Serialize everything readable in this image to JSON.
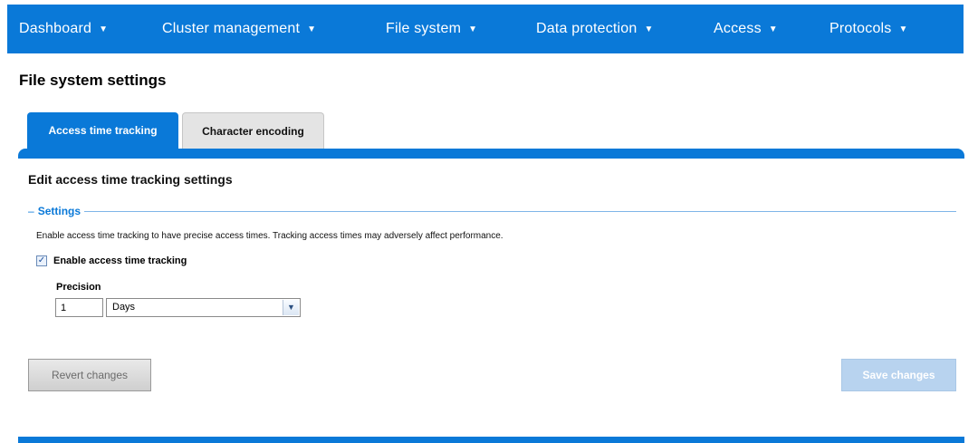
{
  "nav": {
    "items": [
      {
        "label": "Dashboard"
      },
      {
        "label": "Cluster management"
      },
      {
        "label": "File system"
      },
      {
        "label": "Data protection"
      },
      {
        "label": "Access"
      },
      {
        "label": "Protocols"
      }
    ],
    "caret": "▼"
  },
  "page": {
    "title": "File system settings"
  },
  "tabs": [
    {
      "label": "Access time tracking",
      "active": true
    },
    {
      "label": "Character encoding",
      "active": false
    }
  ],
  "panel": {
    "heading": "Edit access time tracking settings",
    "legend": "Settings",
    "legend_dash": "–",
    "description": "Enable access time tracking to have precise access times. Tracking access times may adversely affect performance.",
    "checkbox": {
      "label": "Enable access time tracking",
      "checked": true,
      "mark": "✓"
    },
    "precision": {
      "label": "Precision",
      "value": "1",
      "unit": "Days",
      "arrow": "▼"
    }
  },
  "buttons": {
    "revert": "Revert changes",
    "save": "Save changes"
  },
  "colors": {
    "brand": "#0a79d8",
    "save_disabled": "#b8d3ef"
  }
}
